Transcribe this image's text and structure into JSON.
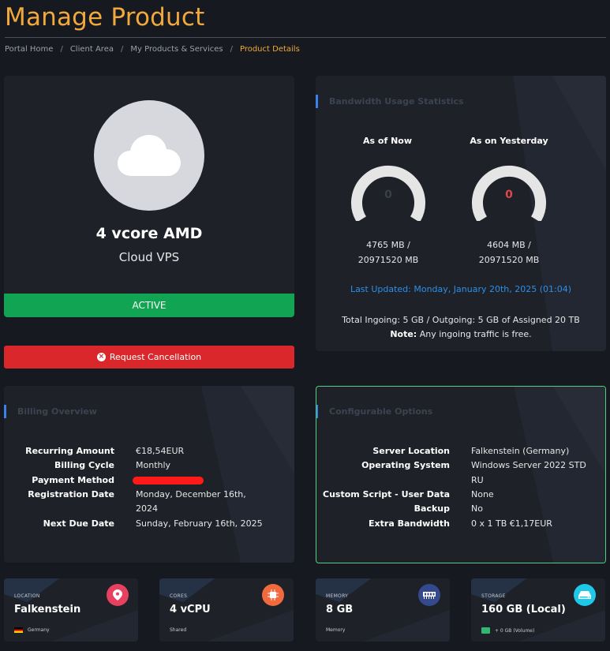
{
  "page": {
    "title": "Manage Product",
    "breadcrumbs": [
      "Portal Home",
      "Client Area",
      "My Products & Services",
      "Product Details"
    ]
  },
  "product": {
    "name": "4 vcore AMD",
    "group": "Cloud VPS",
    "status": "ACTIVE",
    "cancel_label": "Request Cancellation"
  },
  "bandwidth": {
    "title": "Bandwidth Usage Statistics",
    "now": {
      "label": "As of Now",
      "value": "0",
      "mb_line1": "4765 MB /",
      "mb_line2": "20971520 MB"
    },
    "yesterday": {
      "label": "As on Yesterday",
      "value": "0",
      "mb_line1": "4604 MB /",
      "mb_line2": "20971520 MB"
    },
    "last_updated": "Last Updated: Monday, January 20th, 2025 (01:04)",
    "total": "Total Ingoing: 5 GB / Outgoing: 5 GB of Assigned 20 TB",
    "note_label": "Note:",
    "note_text": "Any ingoing traffic is free."
  },
  "billing": {
    "title": "Billing Overview",
    "recurring_label": "Recurring Amount",
    "recurring_value": "€18,54EUR",
    "cycle_label": "Billing Cycle",
    "cycle_value": "Monthly",
    "payment_label": "Payment Method",
    "regdate_label": "Registration Date",
    "regdate_line1": "Monday, December 16th,",
    "regdate_line2": "2024",
    "nextdue_label": "Next Due Date",
    "nextdue_value": "Sunday, February 16th, 2025"
  },
  "config": {
    "title": "Configurable Options",
    "location_label": "Server Location",
    "location_value": "Falkenstein (Germany)",
    "os_label": "Operating System",
    "os_line1": "Windows Server 2022 STD",
    "os_line2": "RU",
    "script_label": "Custom Script - User Data",
    "script_value": "None",
    "backup_label": "Backup",
    "backup_value": "No",
    "bandwidth_label": "Extra Bandwidth",
    "bandwidth_value": "0 x 1 TB €1,17EUR"
  },
  "stats": [
    {
      "caption": "LOCATION",
      "value": "Falkenstein",
      "sub": "Germany",
      "icon": "map-pin-icon",
      "color": "#e8405f"
    },
    {
      "caption": "CORES",
      "value": "4 vCPU",
      "sub": "Shared",
      "icon": "cpu-icon",
      "color": "#f06a3d"
    },
    {
      "caption": "MEMORY",
      "value": "8 GB",
      "sub": "Memory",
      "icon": "memory-icon",
      "color": "#344a8c"
    },
    {
      "caption": "STORAGE",
      "value": "160 GB (Local)",
      "sub": "+ 0 GB (Volume)",
      "icon": "hard-drive-icon",
      "color": "#1ec8e8"
    }
  ],
  "colors": {
    "accent": "#f2a93b",
    "active": "#11a452",
    "danger": "#d9272b",
    "link": "#2f8ee6",
    "gauge_zero": "#e04848"
  }
}
